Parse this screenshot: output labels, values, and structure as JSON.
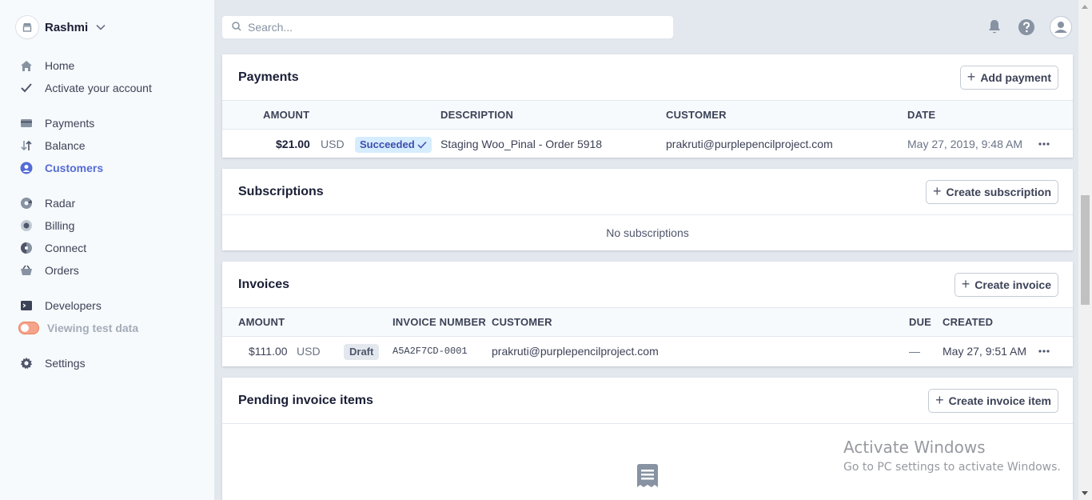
{
  "account": {
    "name": "Rashmi"
  },
  "sidebar": {
    "items": [
      {
        "label": "Home",
        "icon": "home-icon"
      },
      {
        "label": "Activate your account",
        "icon": "checkmark-icon"
      },
      {
        "label": "Payments",
        "icon": "payments-icon"
      },
      {
        "label": "Balance",
        "icon": "balance-icon"
      },
      {
        "label": "Customers",
        "icon": "customers-icon"
      },
      {
        "label": "Radar",
        "icon": "radar-icon"
      },
      {
        "label": "Billing",
        "icon": "billing-icon"
      },
      {
        "label": "Connect",
        "icon": "connect-icon"
      },
      {
        "label": "Orders",
        "icon": "orders-icon"
      },
      {
        "label": "Developers",
        "icon": "developers-icon"
      },
      {
        "label": "Viewing test data",
        "icon": "toggle-switch"
      },
      {
        "label": "Settings",
        "icon": "gear-icon"
      }
    ],
    "active": "Customers"
  },
  "search": {
    "placeholder": "Search..."
  },
  "payments": {
    "title": "Payments",
    "button": "Add payment",
    "columns": [
      "AMOUNT",
      "DESCRIPTION",
      "CUSTOMER",
      "DATE"
    ],
    "rows": [
      {
        "amount": "$21.00",
        "currency": "USD",
        "status": "Succeeded",
        "description": "Staging Woo_Pinal - Order 5918",
        "customer": "prakruti@purplepencilproject.com",
        "date": "May 27, 2019, 9:48 AM"
      }
    ]
  },
  "subscriptions": {
    "title": "Subscriptions",
    "button": "Create subscription",
    "empty": "No subscriptions"
  },
  "invoices": {
    "title": "Invoices",
    "button": "Create invoice",
    "columns": [
      "AMOUNT",
      "INVOICE NUMBER",
      "CUSTOMER",
      "DUE",
      "CREATED"
    ],
    "rows": [
      {
        "amount": "$111.00",
        "currency": "USD",
        "status": "Draft",
        "number": "A5A2F7CD-0001",
        "customer": "prakruti@purplepencilproject.com",
        "due": "—",
        "created": "May 27, 9:51 AM"
      }
    ]
  },
  "pending": {
    "title": "Pending invoice items",
    "button": "Create invoice item"
  },
  "watermark": {
    "line1": "Activate Windows",
    "line2": "Go to PC settings to activate Windows."
  },
  "colors": {
    "accent": "#556cd6",
    "background": "#e3e8ee",
    "success_badge": "#d6ecff"
  }
}
